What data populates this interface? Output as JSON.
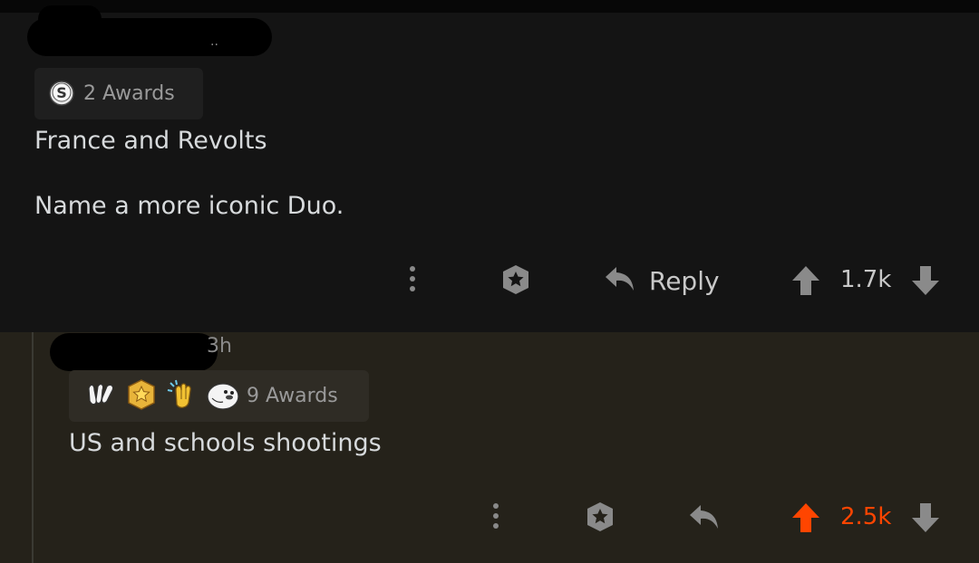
{
  "comments": [
    {
      "meta_dots": "..",
      "awards_label": "2 Awards",
      "body_lines": [
        "France and Revolts",
        "Name a more iconic Duo."
      ],
      "actions": {
        "reply_label": "Reply",
        "score": "1.7k",
        "upvoted": false
      }
    },
    {
      "time": "3h",
      "awards_label": "9 Awards",
      "body_lines": [
        "US and schools shootings"
      ],
      "actions": {
        "score": "2.5k",
        "upvoted": true
      }
    }
  ],
  "colors": {
    "upvote_accent": "#ff4500",
    "icon_gray": "#8a8a8a",
    "comment1_bg": "#141414",
    "comment2_bg": "#25221a"
  },
  "icons": [
    "more-options-icon",
    "award-give-icon",
    "reply-arrow-icon",
    "upvote-arrow-icon",
    "downvote-arrow-icon",
    "silver-award-icon",
    "wholesome-award-icon",
    "star-award-icon",
    "clap-award-icon",
    "seal-award-icon"
  ]
}
